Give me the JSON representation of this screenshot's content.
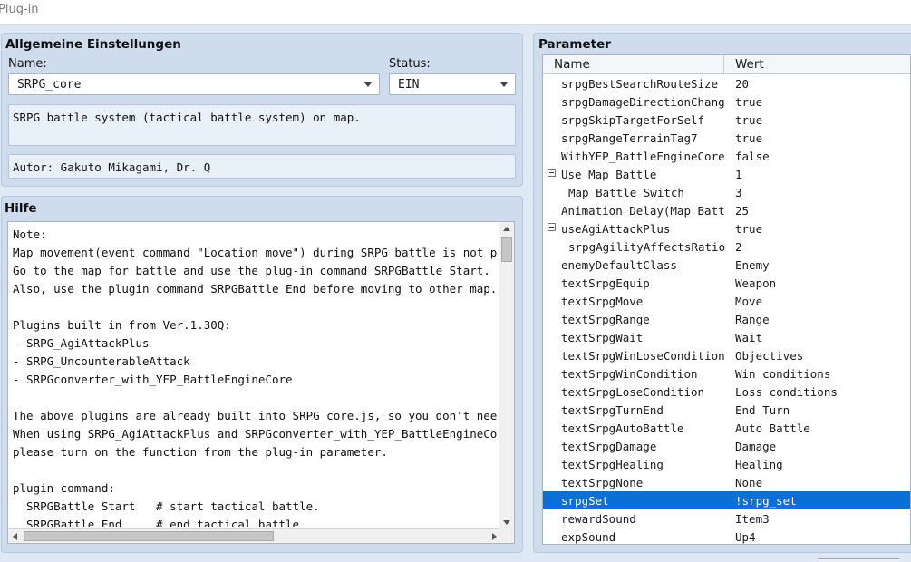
{
  "window": {
    "title": "Plug-in"
  },
  "general": {
    "title": "Allgemeine Einstellungen",
    "name_label": "Name:",
    "name_value": "SRPG_core",
    "status_label": "Status:",
    "status_value": "EIN",
    "description": "SRPG battle system (tactical battle system) on map.",
    "author": "Autor: Gakuto Mikagami, Dr. Q"
  },
  "help": {
    "title": "Hilfe",
    "lines": [
      "Note:",
      "Map movement(event command \"Location move\") during SRPG battle is not possible",
      "Go to the map for battle and use the plug-in command SRPGBattle Start.",
      "Also, use the plugin command SRPGBattle End before moving to other map.",
      "",
      "Plugins built in from Ver.1.30Q:",
      "- SRPG_AgiAttackPlus",
      "- SRPG_UncounterableAttack",
      "- SRPGconverter_with_YEP_BattleEngineCore",
      "",
      "The above plugins are already built into SRPG_core.js, so you don't need to ins",
      "When using SRPG_AgiAttackPlus and SRPGconverter_with_YEP_BattleEngineCore,",
      "please turn on the function from the plug-in parameter.",
      "",
      "plugin command:",
      "  SRPGBattle Start   # start tactical battle.",
      "  SRPGBattle End     # end tactical battle."
    ]
  },
  "parameters": {
    "title": "Parameter",
    "col_name": "Name",
    "col_value": "Wert",
    "rows": [
      {
        "name": "srpgBestSearchRouteSize",
        "value": "20"
      },
      {
        "name": "srpgDamageDirectionChange",
        "value": "true"
      },
      {
        "name": "srpgSkipTargetForSelf",
        "value": "true"
      },
      {
        "name": "srpgRangeTerrainTag7",
        "value": "true"
      },
      {
        "name": "WithYEP_BattleEngineCore",
        "value": "false"
      },
      {
        "name": "Use Map Battle",
        "value": "1"
      },
      {
        "name": "Map Battle Switch",
        "value": "3"
      },
      {
        "name": "Animation Delay(Map Batt···",
        "value": "25"
      },
      {
        "name": "useAgiAttackPlus",
        "value": "true"
      },
      {
        "name": "srpgAgilityAffectsRatio",
        "value": "2"
      },
      {
        "name": "enemyDefaultClass",
        "value": "Enemy"
      },
      {
        "name": "textSrpgEquip",
        "value": "Weapon"
      },
      {
        "name": "textSrpgMove",
        "value": "Move"
      },
      {
        "name": "textSrpgRange",
        "value": "Range"
      },
      {
        "name": "textSrpgWait",
        "value": "Wait"
      },
      {
        "name": "textSrpgWinLoseCondition",
        "value": "Objectives"
      },
      {
        "name": "textSrpgWinCondition",
        "value": "Win conditions"
      },
      {
        "name": "textSrpgLoseCondition",
        "value": "Loss conditions"
      },
      {
        "name": "textSrpgTurnEnd",
        "value": "End Turn"
      },
      {
        "name": "textSrpgAutoBattle",
        "value": "Auto Battle"
      },
      {
        "name": "textSrpgDamage",
        "value": "Damage"
      },
      {
        "name": "textSrpgHealing",
        "value": "Healing"
      },
      {
        "name": "textSrpgNone",
        "value": "None"
      },
      {
        "name": "srpgSet",
        "value": "!srpg_set"
      },
      {
        "name": "rewardSound",
        "value": "Item3"
      },
      {
        "name": "expSound",
        "value": "Up4"
      }
    ]
  },
  "colors": {
    "selection": "#0a6fd6",
    "panel": "#cfdced"
  }
}
